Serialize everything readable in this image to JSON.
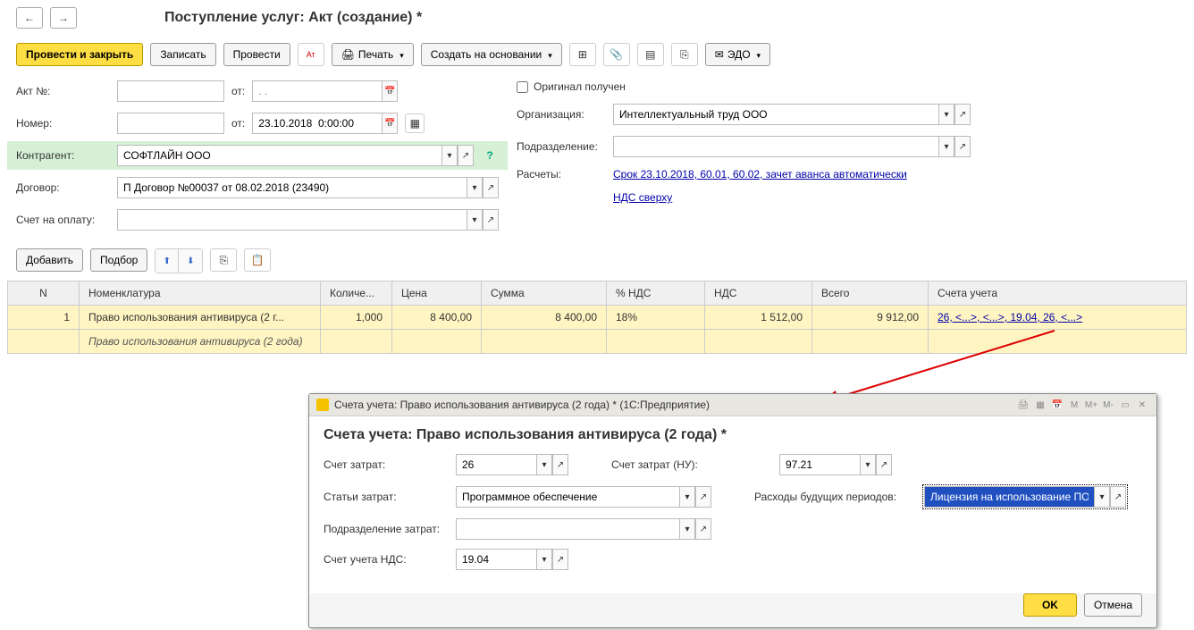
{
  "header": {
    "title": "Поступление услуг: Акт (создание) *"
  },
  "toolbar": {
    "post_close": "Провести и закрыть",
    "save": "Записать",
    "post": "Провести",
    "print": "Печать",
    "create_based": "Создать на основании",
    "edo": "ЭДО"
  },
  "form": {
    "akt_no_label": "Акт №:",
    "from_label": "от:",
    "date_placeholder": ". .",
    "number_label": "Номер:",
    "date_value": "23.10.2018  0:00:00",
    "kontragent_label": "Контрагент:",
    "kontragent_value": "СОФТЛАЙН ООО",
    "dogovor_label": "Договор:",
    "dogovor_value": "П Договор №00037 от 08.02.2018 (23490)",
    "invoice_label": "Счет на оплату:",
    "original_label": "Оригинал получен",
    "organization_label": "Организация:",
    "organization_value": "Интеллектуальный труд ООО",
    "podrazdelenie_label": "Подразделение:",
    "raschety_label": "Расчеты:",
    "raschety_link": "Срок 23.10.2018, 60.01, 60.02, зачет аванса автоматически",
    "nds_link": "НДС сверху"
  },
  "table_toolbar": {
    "add": "Добавить",
    "pick": "Подбор"
  },
  "table": {
    "headers": {
      "n": "N",
      "nomenklatura": "Номенклатура",
      "qty": "Количе...",
      "price": "Цена",
      "sum": "Сумма",
      "vat_pct": "% НДС",
      "vat": "НДС",
      "total": "Всего",
      "accounts": "Счета учета"
    },
    "row": {
      "n": "1",
      "nomenklatura": "Право использования антивируса (2 г...",
      "desc": "Право использования антивируса (2 года)",
      "qty": "1,000",
      "price": "8 400,00",
      "sum": "8 400,00",
      "vat_pct": "18%",
      "vat": "1 512,00",
      "total": "9 912,00",
      "accounts": "26, <...>, <...>, 19.04, 26, <...>"
    }
  },
  "dialog": {
    "win_title": "Счета учета: Право использования антивируса (2 года) *  (1С:Предприятие)",
    "heading": "Счета учета: Право использования антивируса (2 года) *",
    "schet_zatrat_label": "Счет затрат:",
    "schet_zatrat_value": "26",
    "schet_zatrat_nu_label": "Счет затрат (НУ):",
    "schet_zatrat_nu_value": "97.21",
    "stati_zatrat_label": "Статьи затрат:",
    "stati_zatrat_value": "Программное обеспечение",
    "rbp_label": "Расходы будущих периодов:",
    "rbp_value": "Лицензия на использование ПО",
    "podrazdelenie_label": "Подразделение затрат:",
    "schet_nds_label": "Счет учета НДС:",
    "schet_nds_value": "19.04",
    "ok": "OK",
    "cancel": "Отмена"
  }
}
